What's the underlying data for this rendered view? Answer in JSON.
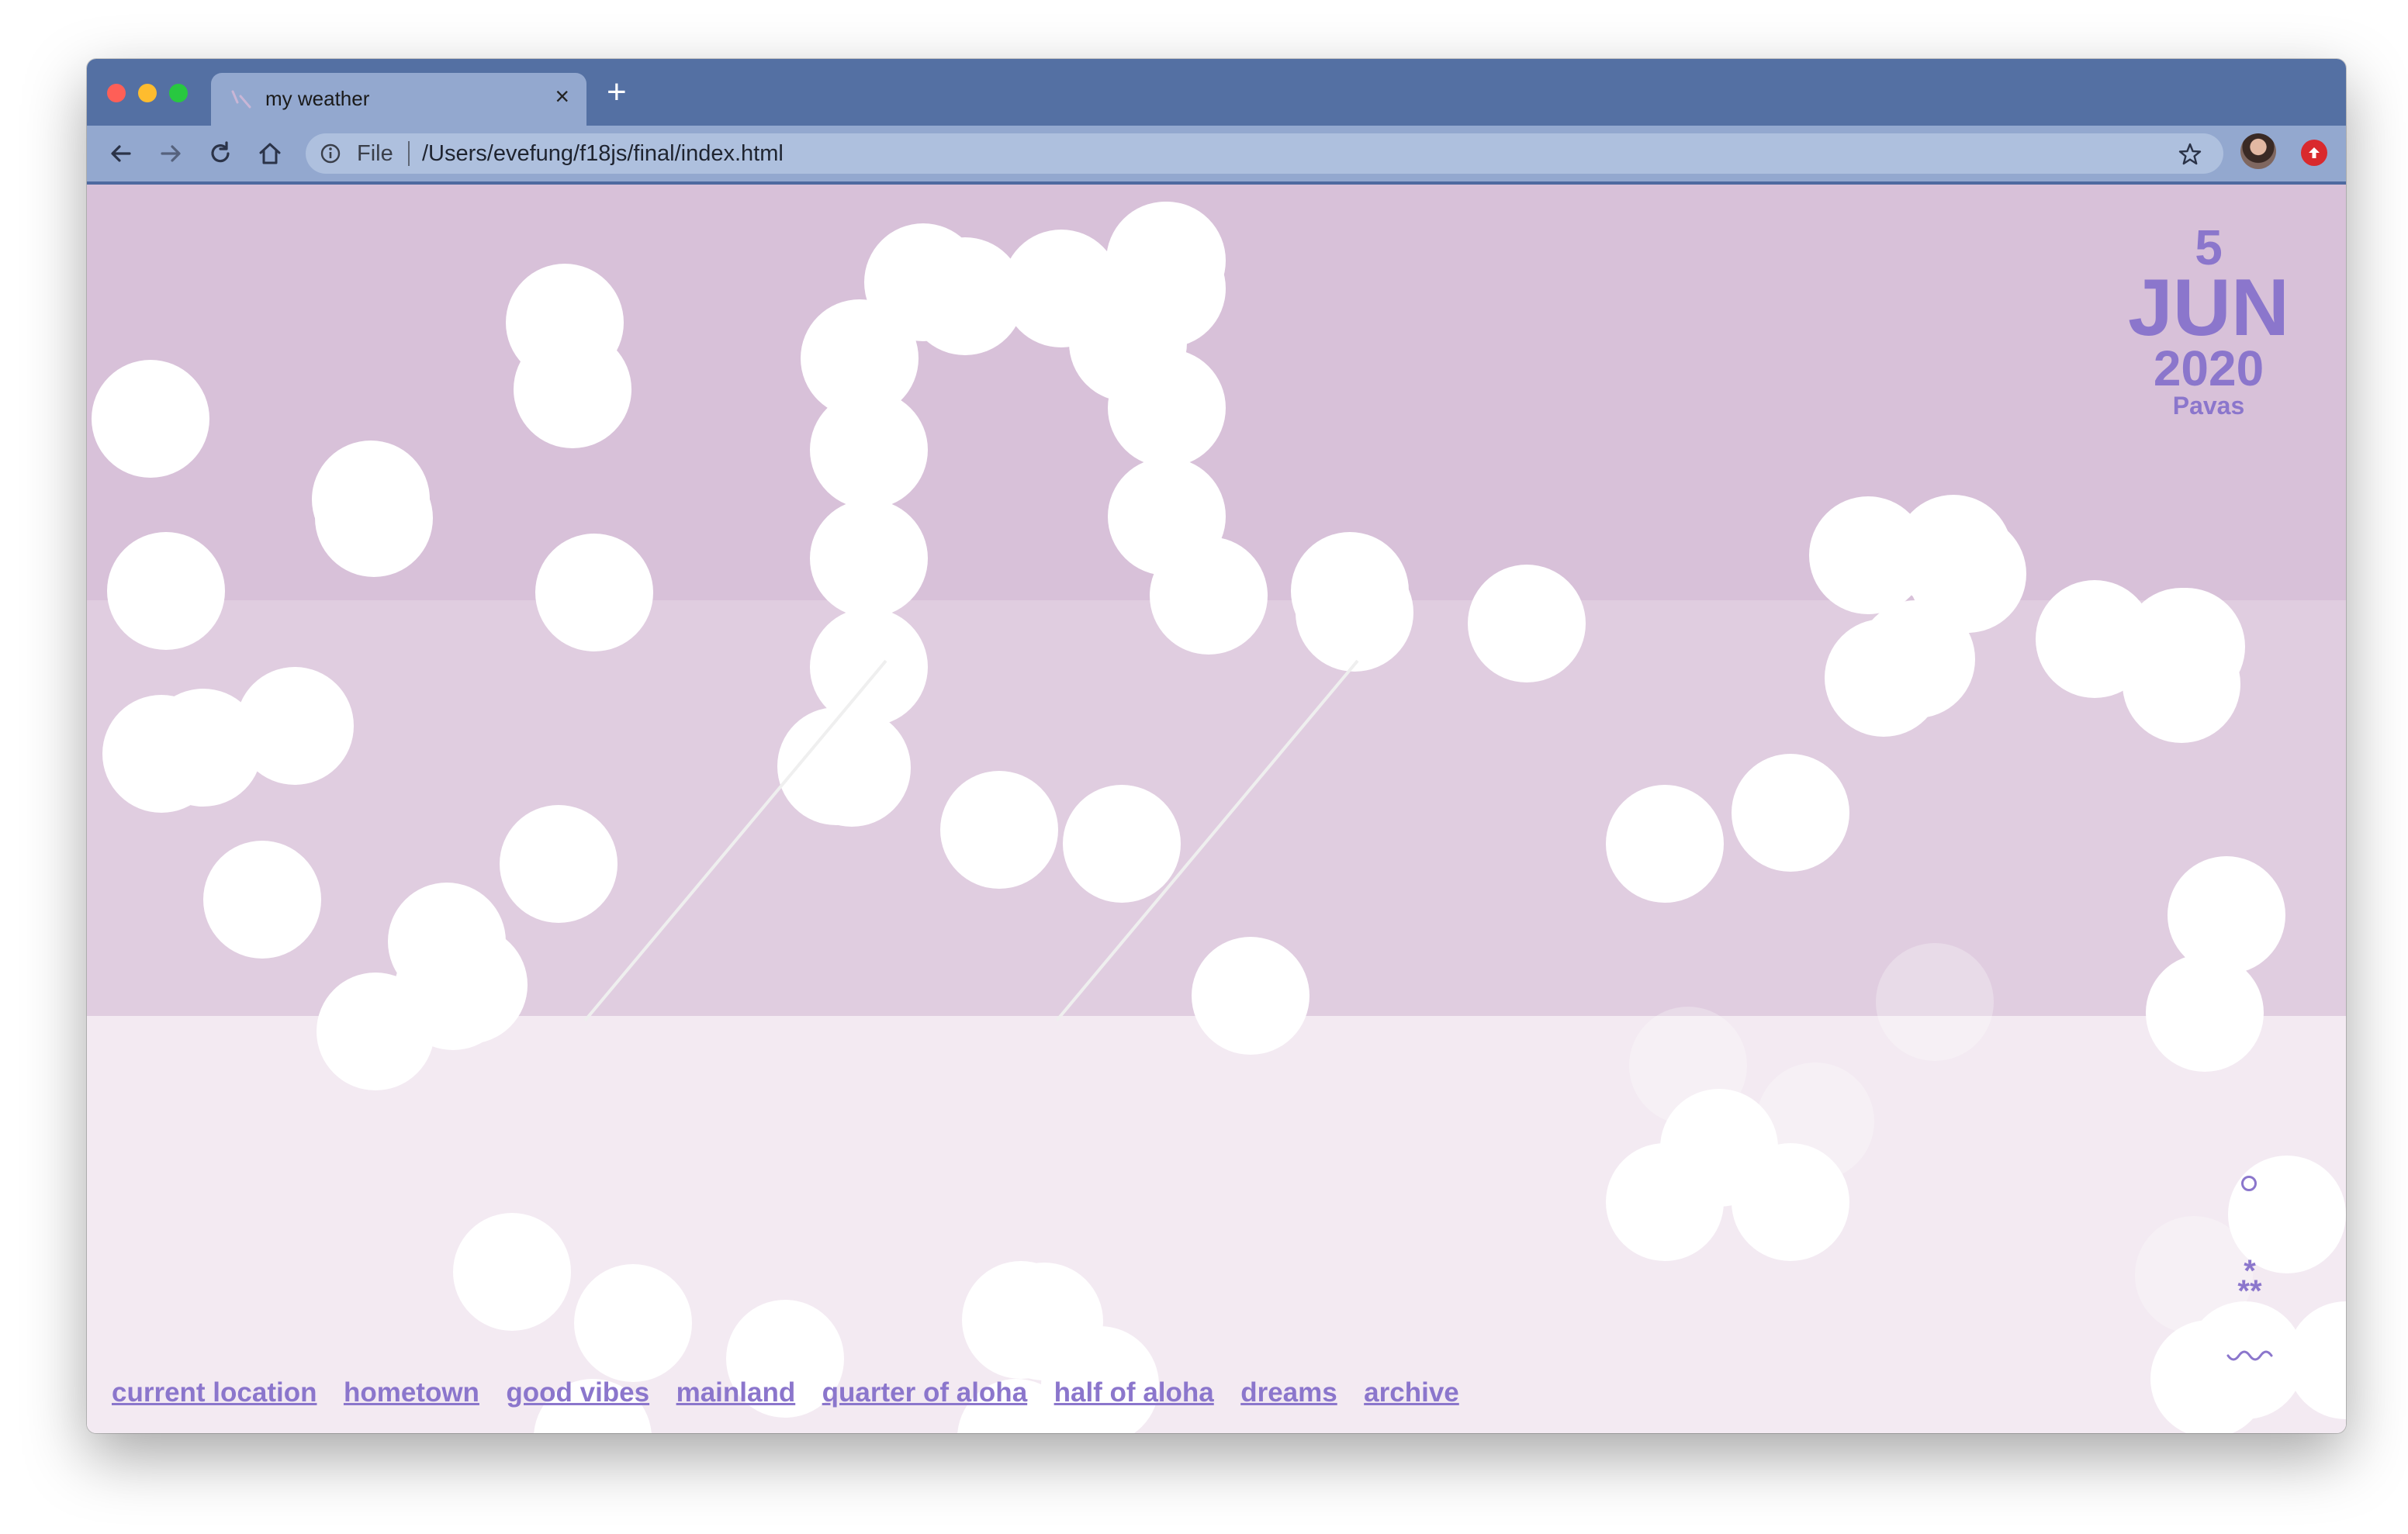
{
  "browser": {
    "tab_title": "my weather",
    "address": {
      "scheme_label": "File",
      "url": "/Users/evefung/f18js/final/index.html"
    }
  },
  "weather_page": {
    "date": {
      "day": "5",
      "month": "JUN",
      "year": "2020",
      "city": "Pavas"
    },
    "side_icons": [
      "circle-icon",
      "snowflake-icon",
      "wave-icon"
    ],
    "nav_links": [
      "current location",
      "hometown",
      "good vibes",
      "mainland",
      "quarter of aloha",
      "half of aloha",
      "dreams",
      "archive"
    ],
    "colors": {
      "accent": "#8b76cc",
      "band_top": "#d8c1d9",
      "band_middle": "#e0cde0",
      "band_bottom": "#f3eaf2",
      "browser_frame": "#5470a3",
      "toolbar": "#93a8cf"
    }
  }
}
